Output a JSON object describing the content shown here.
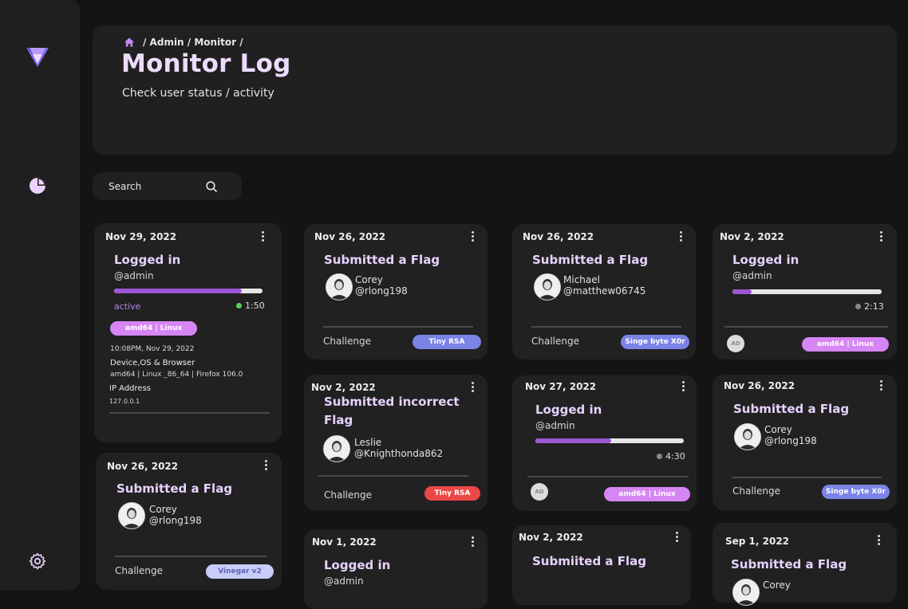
{
  "breadcrumb": {
    "path": "/ Admin / Monitor /"
  },
  "page": {
    "title": "Monitor Log",
    "subtitle": "Check user status / activity"
  },
  "search": {
    "placeholder": "Search"
  },
  "cards": {
    "c1": {
      "date": "Nov 29, 2022",
      "title": "Logged in",
      "handle": "@admin",
      "progress": 0.86,
      "status": "active",
      "time": "1:50",
      "device_badge": "amd64 | Linux",
      "timestamp": "10:08PM, Nov 29, 2022",
      "device_label": "Device,OS & Browser",
      "device_value": "amd64  | Linux _86_64 | Firefox  106.0",
      "ip_label": "IP Address",
      "ip_value": "127.0.0.1"
    },
    "c2": {
      "date": "Nov 26, 2022",
      "title": "Submitted a Flag",
      "user_name": "Corey",
      "user_handle": "@rlong198",
      "challenge_label": "Challenge",
      "challenge": "Vinegar v2"
    },
    "c3": {
      "date": "Nov 26, 2022",
      "title": "Submitted a Flag",
      "user_name": "Corey",
      "user_handle": "@rlong198",
      "challenge_label": "Challenge",
      "challenge": "Tiny RSA"
    },
    "c4": {
      "date": "Nov 2, 2022",
      "title": "Submitted incorrect Flag",
      "user_name": "Leslie",
      "user_handle": "@Knighthonda862",
      "challenge_label": "Challenge",
      "challenge": "Tiny RSA"
    },
    "c5": {
      "date": "Nov 1, 2022",
      "title": "Logged in",
      "handle": "@admin"
    },
    "c6": {
      "date": "Nov 26, 2022",
      "title": "Submitted a Flag",
      "user_name": "Michael",
      "user_handle": "@matthew06745",
      "challenge_label": "Challenge",
      "challenge": "Singe byte X0r"
    },
    "c7": {
      "date": "Nov 27, 2022",
      "title": "Logged in",
      "handle": "@admin",
      "progress": 0.51,
      "time": "4:30",
      "avatar_initials": "AD",
      "device_badge": "amd64 | Linux"
    },
    "c8": {
      "date": "Nov 2, 2022",
      "title": "Submiited a Flag"
    },
    "c9": {
      "date": "Nov 2, 2022",
      "title": "Logged in",
      "handle": "@admin",
      "progress": 0.13,
      "time": "2:13",
      "avatar_initials": "AD",
      "device_badge": "amd64 | Linux"
    },
    "c10": {
      "date": "Nov 26, 2022",
      "title": "Submitted a Flag",
      "user_name": "Corey",
      "user_handle": "@rlong198",
      "challenge_label": "Challenge",
      "challenge": "Singe byte X0r"
    },
    "c11": {
      "date": "Sep 1, 2022",
      "title": "Submitted a Flag",
      "user_name": "Corey"
    }
  },
  "colors": {
    "accent_purple": "#9a56d4",
    "badge_pink": "#d686f3",
    "badge_blue": "#7b83e6",
    "badge_red": "#ec4848",
    "title_lavender": "#e6d2ff"
  }
}
